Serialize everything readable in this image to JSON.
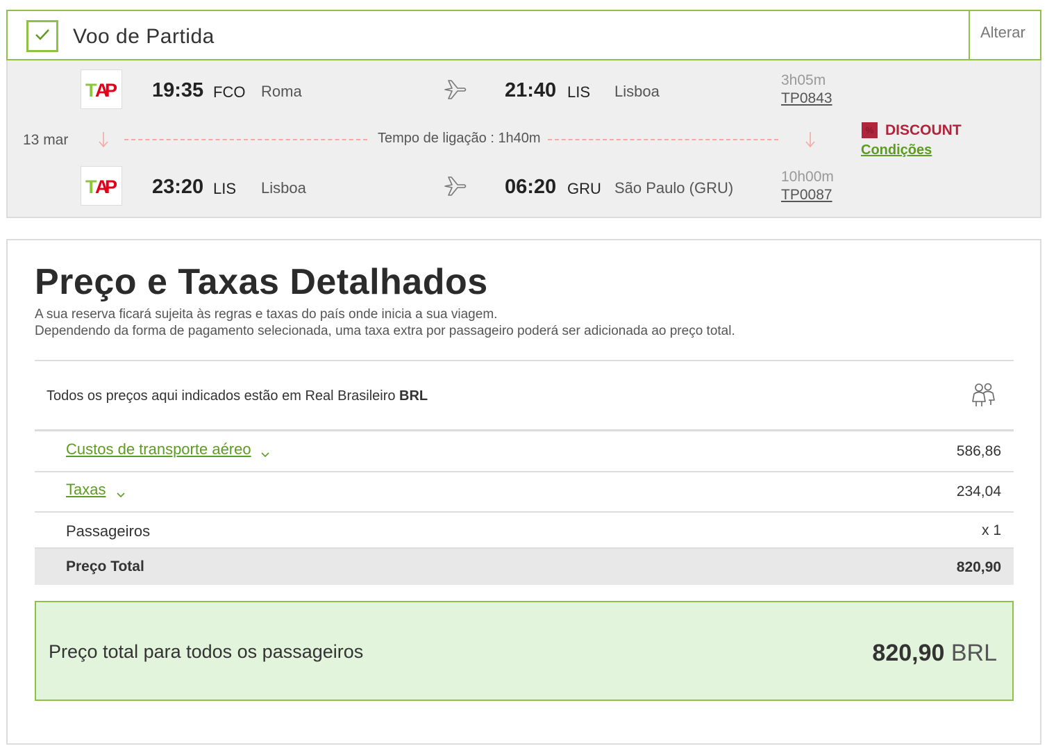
{
  "flight_header": {
    "title": "Voo de Partida",
    "change_label": "Alterar"
  },
  "segments": [
    {
      "airline_logo": "TAP",
      "dep_time": "19:35",
      "dep_code": "FCO",
      "dep_city": "Roma",
      "arr_time": "21:40",
      "arr_code": "LIS",
      "arr_city": "Lisboa",
      "duration": "3h05m",
      "flight_no": "TP0843"
    },
    {
      "airline_logo": "TAP",
      "dep_time": "23:20",
      "dep_code": "LIS",
      "dep_city": "Lisboa",
      "arr_time": "06:20",
      "arr_code": "GRU",
      "arr_city": "São Paulo (GRU)",
      "duration": "10h00m",
      "flight_no": "TP0087"
    }
  ],
  "connection": {
    "date": "13 mar",
    "label": "Tempo de ligação : 1h40m"
  },
  "discount": {
    "badge": "%",
    "label": "DISCOUNT",
    "conditions_link": "Condições"
  },
  "price": {
    "title": "Preço e Taxas Detalhados",
    "subtitle_1": "A sua reserva ficará sujeita às regras e taxas do país onde inicia a sua viagem.",
    "subtitle_2": "Dependendo da forma de pagamento selecionada, uma taxa extra por passageiro poderá ser adicionada ao preço total.",
    "currency_note": "Todos os preços aqui indicados estão em Real Brasileiro ",
    "currency_code": "BRL",
    "rows": [
      {
        "label": "Custos de transporte aéreo",
        "value": "586,86"
      },
      {
        "label": "Taxas",
        "value": "234,04"
      },
      {
        "label": "Passageiros",
        "value": "x 1"
      },
      {
        "label": "Preço Total",
        "value": "820,90"
      }
    ],
    "grand_total_label": "Preço total para todos os passageiros",
    "grand_total_value": "820,90",
    "grand_total_currency": "BRL"
  },
  "colors": {
    "accent_green": "#8fc146",
    "link_green": "#5e9b21",
    "discount_red": "#b0243c",
    "tap_green": "#8cc63f",
    "tap_red": "#e3001b"
  },
  "icons": [
    "check-icon",
    "plane-icon",
    "arrow-down-icon",
    "chevron-down-icon",
    "people-icon",
    "tap-logo"
  ]
}
